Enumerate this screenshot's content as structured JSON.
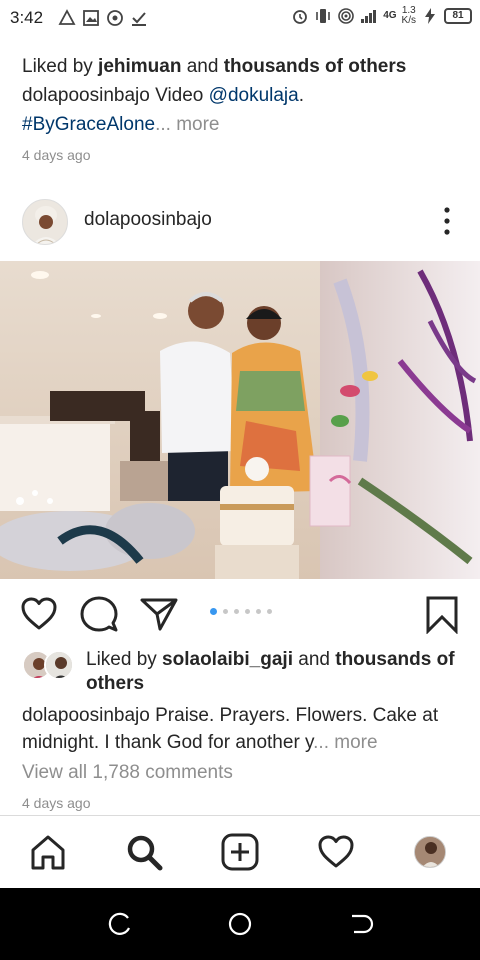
{
  "status_bar": {
    "time": "3:42",
    "network": "4G",
    "speed_value": "1.3",
    "speed_unit": "K/s",
    "battery": "81",
    "left_icons": [
      "drive-icon",
      "image-icon",
      "hotspot-icon",
      "check-download-icon"
    ],
    "right_icons": [
      "alarm-icon",
      "vibrate-icon",
      "hotspot-icon",
      "signal-icon",
      "charging-icon"
    ]
  },
  "previous_post": {
    "liked_prefix": "Liked by ",
    "liked_user": "jehimuan",
    "liked_and": " and ",
    "liked_rest": "thousands of others",
    "caption_user": "dolapoosinbajo",
    "caption_text": " Video ",
    "caption_mention": "@dokulaja",
    "caption_end": ".",
    "hashtag": "#ByGraceAlone",
    "ellipsis": "...",
    "more": " more",
    "timestamp": "4 days ago"
  },
  "post": {
    "username": "dolapoosinbajo",
    "carousel_total": 6,
    "carousel_active": 0,
    "liked_prefix": "Liked by ",
    "liked_user": "solaolaibi_gaji",
    "liked_and": " and ",
    "liked_rest": "thousands of others",
    "caption_user": "dolapoosinbajo",
    "caption_text": " Praise. Prayers. Flowers. Cake at midnight. I thank God for another y",
    "ellipsis": "...",
    "more": " more",
    "view_comments": "View all 1,788 comments",
    "timestamp": "4 days ago"
  },
  "colors": {
    "accent_blue": "#3897f0",
    "link": "#00376b",
    "muted": "#8e8e8e",
    "text": "#262626"
  },
  "bottom_nav": [
    "home-icon",
    "search-icon",
    "add-post-icon",
    "activity-heart-icon",
    "profile-avatar"
  ],
  "android_nav": [
    "recents-icon",
    "home-circle-icon",
    "back-icon"
  ]
}
